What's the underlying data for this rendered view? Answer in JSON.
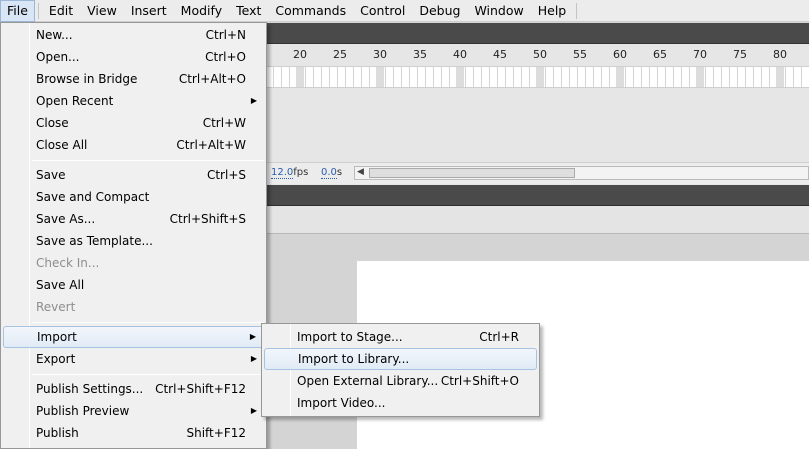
{
  "menubar": {
    "items": [
      "File",
      "Edit",
      "View",
      "Insert",
      "Modify",
      "Text",
      "Commands",
      "Control",
      "Debug",
      "Window",
      "Help"
    ]
  },
  "timeline": {
    "ruler": [
      "20",
      "25",
      "30",
      "35",
      "40",
      "45",
      "50",
      "55",
      "60",
      "65",
      "70",
      "75",
      "80"
    ],
    "fps_value": "12.0",
    "fps_unit": "fps",
    "time_value": "0.0",
    "time_unit": "s"
  },
  "file_menu": {
    "items": [
      {
        "label": "New...",
        "shortcut": "Ctrl+N"
      },
      {
        "label": "Open...",
        "shortcut": "Ctrl+O"
      },
      {
        "label": "Browse in Bridge",
        "shortcut": "Ctrl+Alt+O"
      },
      {
        "label": "Open Recent",
        "shortcut": ""
      },
      {
        "label": "Close",
        "shortcut": "Ctrl+W"
      },
      {
        "label": "Close All",
        "shortcut": "Ctrl+Alt+W"
      },
      {
        "label": "Save",
        "shortcut": "Ctrl+S"
      },
      {
        "label": "Save and Compact",
        "shortcut": ""
      },
      {
        "label": "Save As...",
        "shortcut": "Ctrl+Shift+S"
      },
      {
        "label": "Save as Template...",
        "shortcut": ""
      },
      {
        "label": "Check In...",
        "shortcut": ""
      },
      {
        "label": "Save All",
        "shortcut": ""
      },
      {
        "label": "Revert",
        "shortcut": ""
      },
      {
        "label": "Import",
        "shortcut": ""
      },
      {
        "label": "Export",
        "shortcut": ""
      },
      {
        "label": "Publish Settings...",
        "shortcut": "Ctrl+Shift+F12"
      },
      {
        "label": "Publish Preview",
        "shortcut": ""
      },
      {
        "label": "Publish",
        "shortcut": "Shift+F12"
      }
    ]
  },
  "import_menu": {
    "items": [
      {
        "label": "Import to Stage...",
        "shortcut": "Ctrl+R"
      },
      {
        "label": "Import to Library...",
        "shortcut": ""
      },
      {
        "label": "Open External Library...",
        "shortcut": "Ctrl+Shift+O"
      },
      {
        "label": "Import Video...",
        "shortcut": ""
      }
    ]
  },
  "icons": {
    "submenu_arrow": "▶",
    "scroll_left_arrow": "◀"
  }
}
